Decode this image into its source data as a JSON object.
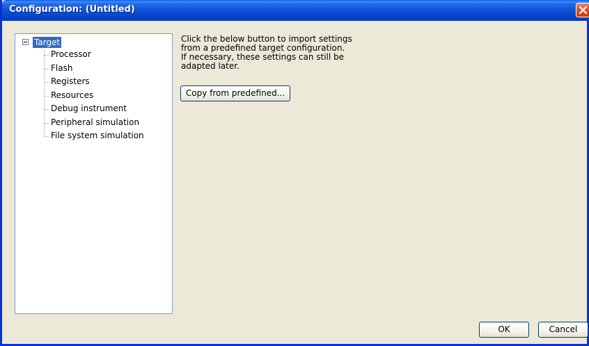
{
  "window": {
    "title": "Configuration: (Untitled)",
    "close_icon": "close-icon",
    "titlebar_color": "#0a4fd6",
    "background_color": "#ece9d8"
  },
  "tree": {
    "root": {
      "label": "Target",
      "expanded": true,
      "selected": true,
      "selection_color": "#316ac5"
    },
    "children": [
      {
        "label": "Processor"
      },
      {
        "label": "Flash"
      },
      {
        "label": "Registers"
      },
      {
        "label": "Resources"
      },
      {
        "label": "Debug instrument"
      },
      {
        "label": "Peripheral simulation"
      },
      {
        "label": "File system simulation"
      }
    ]
  },
  "content": {
    "description_lines": [
      "Click the below button to import settings",
      "from a predefined target configuration.",
      "If necessary, these settings can still be",
      "adapted later."
    ],
    "copy_button_label": "Copy from predefined..."
  },
  "footer": {
    "ok_label": "OK",
    "cancel_label": "Cancel"
  }
}
